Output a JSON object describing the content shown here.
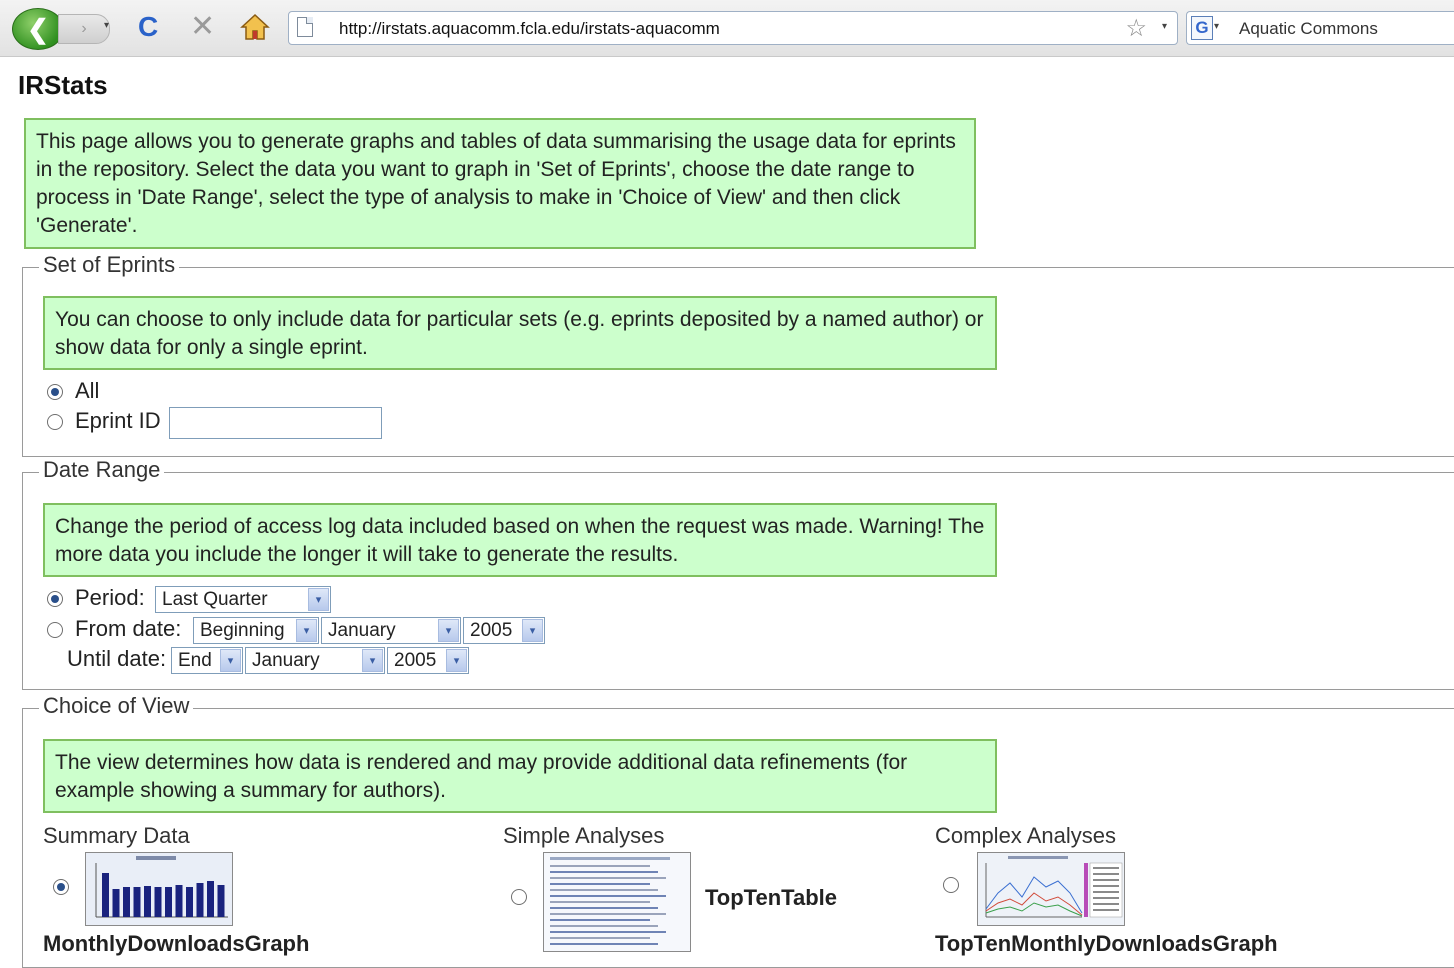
{
  "browser": {
    "back_glyph": "❮",
    "forward_glyph": "›",
    "reload_glyph": "C",
    "stop_glyph": "✕",
    "url": "http://irstats.aquacomm.fcla.edu/irstats-aquacomm",
    "star_glyph": "☆",
    "search_text": "Aquatic Commons",
    "g_logo": "G",
    "dropdown_glyph": "▾"
  },
  "page": {
    "title": "IRStats",
    "intro": "This page allows you to generate graphs and tables of data summarising the usage data for eprints in the repository. Select the data you want to graph in 'Set of Eprints', choose the date range to process in 'Date Range', select the type of analysis to make in 'Choice of View' and then click 'Generate'."
  },
  "set_of_eprints": {
    "legend": "Set of Eprints",
    "info": "You can choose to only include data for particular sets (e.g. eprints deposited by a named author) or show data for only a single eprint.",
    "option_all": "All",
    "option_eprint_id": "Eprint ID",
    "eprint_id_value": "",
    "selected": "All"
  },
  "date_range": {
    "legend": "Date Range",
    "info": "Change the period of access log data included based on when the request was made. Warning! The more data you include the longer it will take to generate the results.",
    "period_label": "Period:",
    "period_value": "Last Quarter",
    "from_label": "From date:",
    "from_day": "Beginning",
    "from_month": "January",
    "from_year": "2005",
    "until_label": "Until date:",
    "until_day": "End",
    "until_month": "January",
    "until_year": "2005",
    "selected": "Period"
  },
  "choice_of_view": {
    "legend": "Choice of View",
    "info": "The view determines how data is rendered and may provide additional data refinements (for example showing a summary for authors).",
    "columns": [
      {
        "heading": "Summary Data",
        "view": "MonthlyDownloadsGraph",
        "selected": true
      },
      {
        "heading": "Simple Analyses",
        "view": "TopTenTable",
        "selected": false
      },
      {
        "heading": "Complex Analyses",
        "view": "TopTenMonthlyDownloadsGraph",
        "selected": false
      }
    ]
  },
  "colors": {
    "info_bg": "#ccffcc",
    "info_border": "#7fbf5f",
    "bar_color": "#1a237e"
  }
}
